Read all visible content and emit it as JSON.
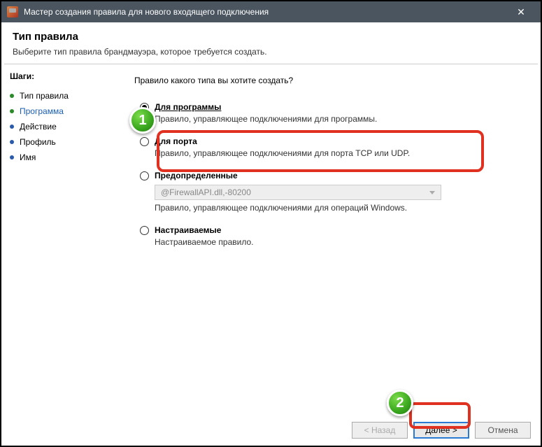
{
  "titlebar": {
    "title": "Мастер создания правила для нового входящего подключения"
  },
  "header": {
    "title": "Тип правила",
    "subtitle": "Выберите тип правила брандмауэра, которое требуется создать."
  },
  "sidebar": {
    "heading": "Шаги:",
    "steps": [
      {
        "label": "Тип правила"
      },
      {
        "label": "Программа"
      },
      {
        "label": "Действие"
      },
      {
        "label": "Профиль"
      },
      {
        "label": "Имя"
      }
    ]
  },
  "content": {
    "question": "Правило какого типа вы хотите создать?",
    "options": {
      "program": {
        "label": "Для программы",
        "desc": "Правило, управляющее подключениями для программы."
      },
      "port": {
        "label": "Для порта",
        "desc": "Правило, управляющее подключениями для порта TCP или UDP."
      },
      "predefined": {
        "label": "Предопределенные",
        "combo": "@FirewallAPI.dll,-80200",
        "desc": "Правило, управляющее подключениями для операций Windows."
      },
      "custom": {
        "label": "Настраиваемые",
        "desc": "Настраиваемое правило."
      }
    }
  },
  "footer": {
    "back": "< Назад",
    "next": "Далее >",
    "cancel": "Отмена"
  },
  "markers": {
    "one": "1",
    "two": "2"
  }
}
